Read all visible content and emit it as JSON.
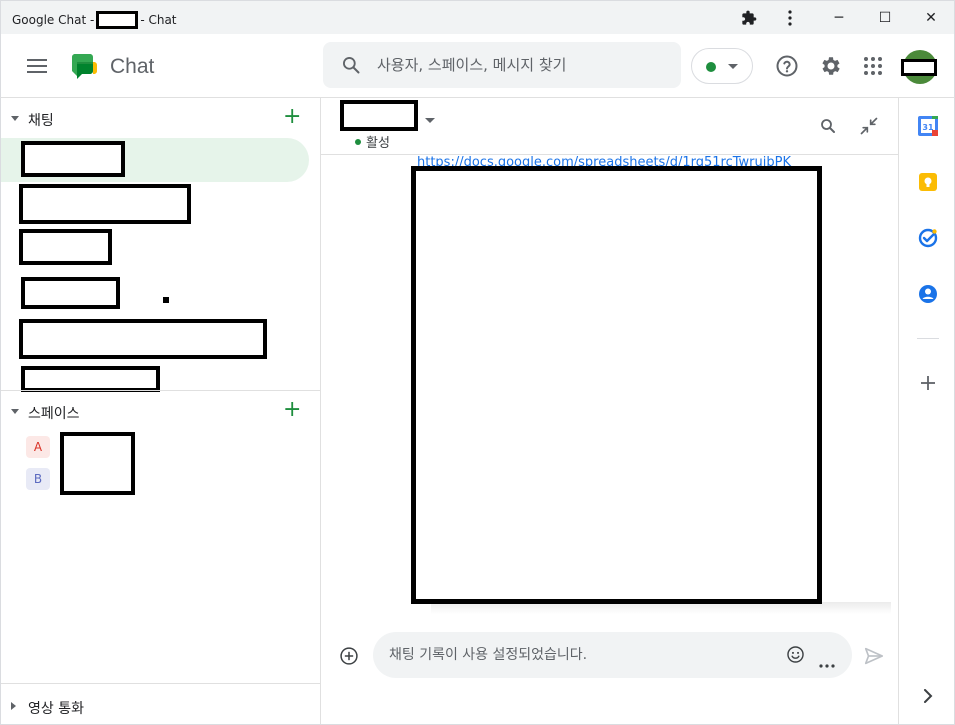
{
  "window": {
    "title_prefix": "Google Chat -",
    "title_suffix": "- Chat",
    "minimize": "─",
    "maximize": "☐",
    "close": "✕"
  },
  "header": {
    "app_name": "Chat",
    "search_placeholder": "사용자, 스페이스, 메시지 찾기",
    "status_color": "#1e8e3e"
  },
  "sidebar": {
    "chats_label": "채팅",
    "spaces_label": "스페이스",
    "spaces": [
      {
        "initial": "A",
        "bg": "#fce8e6",
        "color": "#d93025"
      },
      {
        "initial": "B",
        "bg": "#e8eaf6",
        "color": "#5c6bc0"
      }
    ],
    "calls_label": "영상 통화"
  },
  "main": {
    "presence_label": "활성",
    "link_text": "https://docs.google.com/spreadsheets/d/1rq51rcTwruibPK",
    "composer_placeholder": "채팅 기록이 사용 설정되었습니다."
  },
  "rail": {
    "calendar_day": "31"
  },
  "colors": {
    "accent_green": "#1e8e3e",
    "link_blue": "#1a73e8",
    "active_row": "#e6f4ea"
  }
}
